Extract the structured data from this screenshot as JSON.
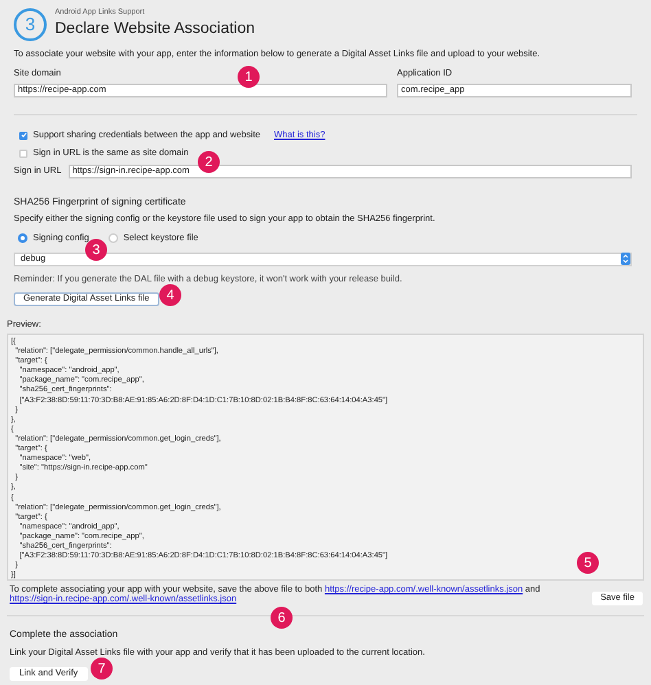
{
  "header": {
    "step": "3",
    "subtitle": "Android App Links Support",
    "title": "Declare Website Association"
  },
  "intro": "To associate your website with your app, enter the information below to generate a Digital Asset Links file and upload to your website.",
  "site_domain": {
    "label": "Site domain",
    "value": "https://recipe-app.com"
  },
  "application_id": {
    "label": "Application ID",
    "value": "com.recipe_app"
  },
  "options": [
    {
      "label": "Support sharing credentials between the app and website",
      "checked": true
    },
    {
      "label": "Sign in URL is the same as site domain",
      "checked": false
    }
  ],
  "help_link": "What is this?",
  "sign_in_url": {
    "label": "Sign in URL",
    "value": "https://sign-in.recipe-app.com"
  },
  "fingerprint": {
    "title": "SHA256 Fingerprint of signing certificate",
    "description": "Specify either the signing config or the keystore file used to sign your app to obtain the SHA256 fingerprint.",
    "sources": [
      {
        "label": "Signing config",
        "selected": true
      },
      {
        "label": "Select keystore file",
        "selected": false
      }
    ],
    "config": "debug",
    "reminder": "Reminder: If you generate the DAL file with a debug keystore, it won't work with your release build."
  },
  "generate_button": "Generate Digital Asset Links file",
  "preview": {
    "label": "Preview:",
    "text": "[{\n  \"relation\": [\"delegate_permission/common.handle_all_urls\"],\n  \"target\": {\n    \"namespace\": \"android_app\",\n    \"package_name\": \"com.recipe_app\",\n    \"sha256_cert_fingerprints\":\n    [\"A3:F2:38:8D:59:11:70:3D:B8:AE:91:85:A6:2D:8F:D4:1D:C1:7B:10:8D:02:1B:B4:8F:8C:63:64:14:04:A3:45\"]\n  }\n},\n{\n  \"relation\": [\"delegate_permission/common.get_login_creds\"],\n  \"target\": {\n    \"namespace\": \"web\",\n    \"site\": \"https://sign-in.recipe-app.com\"\n  }\n},\n{\n  \"relation\": [\"delegate_permission/common.get_login_creds\"],\n  \"target\": {\n    \"namespace\": \"android_app\",\n    \"package_name\": \"com.recipe_app\",\n    \"sha256_cert_fingerprints\":\n    [\"A3:F2:38:8D:59:11:70:3D:B8:AE:91:85:A6:2D:8F:D4:1D:C1:7B:10:8D:02:1B:B4:8F:8C:63:64:14:04:A3:45\"]\n  }\n}]"
  },
  "save_note": {
    "before": "To complete associating your app with your website, save the above file to both",
    "links": [
      "https://recipe-app.com/.well-known/assetlinks.json",
      "https://sign-in.recipe-app.com/.well-known/assetlinks.json"
    ],
    "between": "and"
  },
  "save_button": "Save file",
  "complete": {
    "title": "Complete the association",
    "description": "Link your Digital Asset Links file with your app and verify that it has been uploaded to the current location.",
    "button": "Link and Verify"
  },
  "callouts": [
    "1",
    "2",
    "3",
    "4",
    "5",
    "6",
    "7"
  ]
}
